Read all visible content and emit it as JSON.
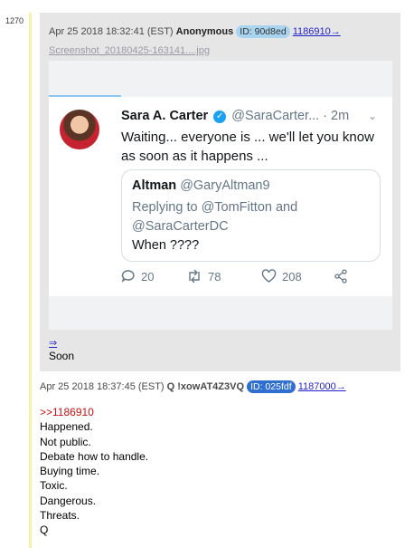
{
  "post_number": "1270",
  "reply": {
    "timestamp": "Apr 25 2018 18:32:41 (EST)",
    "author": "Anonymous",
    "id_badge": "ID: 90d8ed",
    "post_link": "1186910→",
    "filename": "Screenshot_20180425-163141....jpg",
    "tweet": {
      "name": "Sara A. Carter",
      "handle": "@SaraCarter...",
      "time": "· 2m",
      "text": "Waiting... everyone is ... we'll let you know as soon as it happens ...",
      "quoted": {
        "name": "Altman",
        "handle": "@GaryAltman9",
        "reply_to": "Replying to @TomFitton and @SaraCarterDC",
        "text": "When ????"
      },
      "reply_count": "20",
      "retweet_count": "78",
      "like_count": "208"
    },
    "arrow_link": "⇒",
    "message": "Soon"
  },
  "op": {
    "timestamp": "Apr 25 2018 18:37:45 (EST)",
    "author": "Q !xowAT4Z3VQ",
    "id_badge": "ID: 025fdf",
    "post_link": "1187000→",
    "quote_link": ">>1186910",
    "lines": [
      "Happened.",
      "Not public.",
      "Debate how to handle.",
      "Buying time.",
      "Toxic.",
      "Dangerous.",
      "Threats.",
      "Q"
    ]
  },
  "colors": {
    "id_light": "#a9d4ef",
    "id_dark": "#2f6fd0",
    "link": "#2222cc",
    "quote_link": "#cc1111",
    "reply_bg": "#e6e6e6"
  }
}
